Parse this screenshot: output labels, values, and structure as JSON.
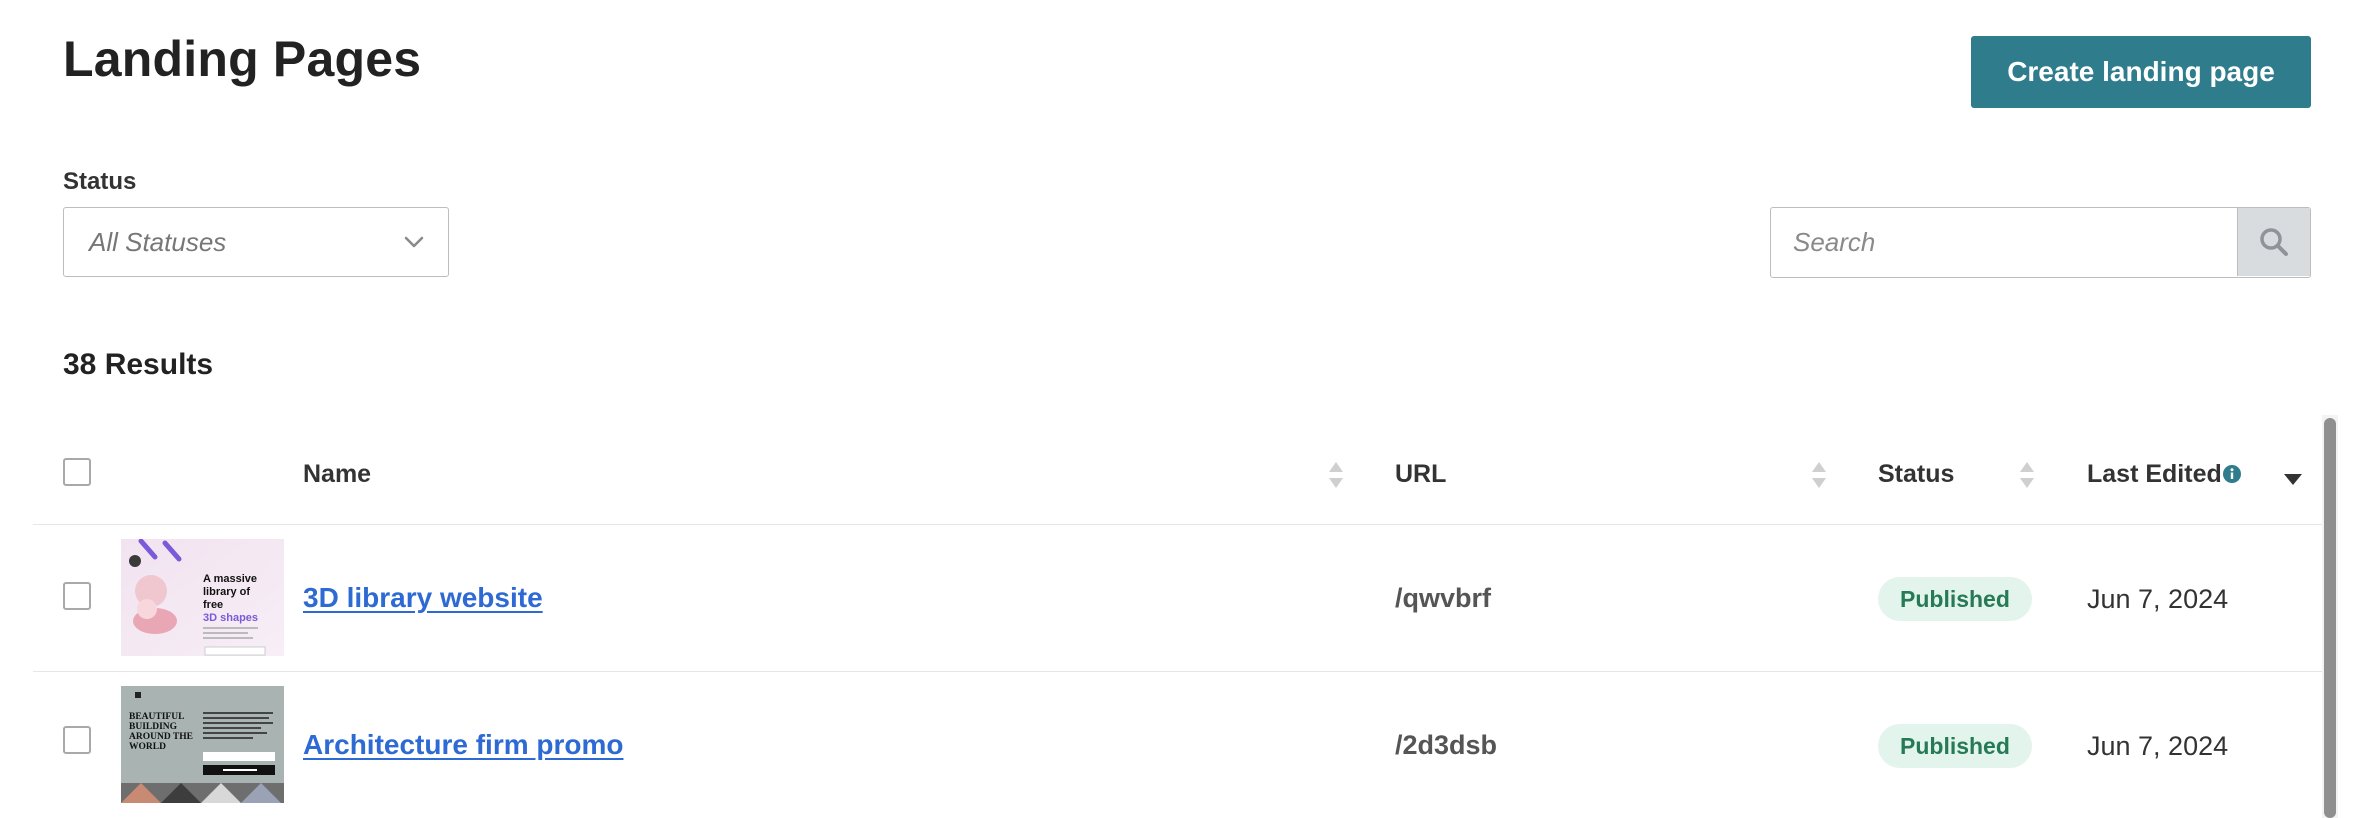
{
  "header": {
    "title": "Landing Pages",
    "create_button": "Create landing page"
  },
  "filters": {
    "status_label": "Status",
    "status_value": "All Statuses",
    "search_placeholder": "Search"
  },
  "results_label": "38 Results",
  "table": {
    "columns": {
      "name": "Name",
      "url": "URL",
      "status": "Status",
      "last_edited": "Last Edited"
    },
    "rows": [
      {
        "name": "3D library website",
        "url": "/qwvbrf",
        "status": "Published",
        "last_edited": "Jun 7, 2024",
        "thumb": {
          "headline_lines": [
            "A massive",
            "library of",
            "free"
          ],
          "headline_accent": "3D shapes"
        }
      },
      {
        "name": "Architecture firm promo",
        "url": "/2d3dsb",
        "status": "Published",
        "last_edited": "Jun 7, 2024",
        "thumb": {
          "headline_lines": [
            "BEAUTIFUL",
            "BUILDING",
            "AROUND THE",
            "WORLD"
          ]
        }
      }
    ]
  },
  "colors": {
    "primary": "#2f7d8c",
    "link": "#2d6ad3",
    "badge_bg": "#e3f4ec",
    "badge_text": "#267a55",
    "info_icon": "#2f7d8c"
  }
}
